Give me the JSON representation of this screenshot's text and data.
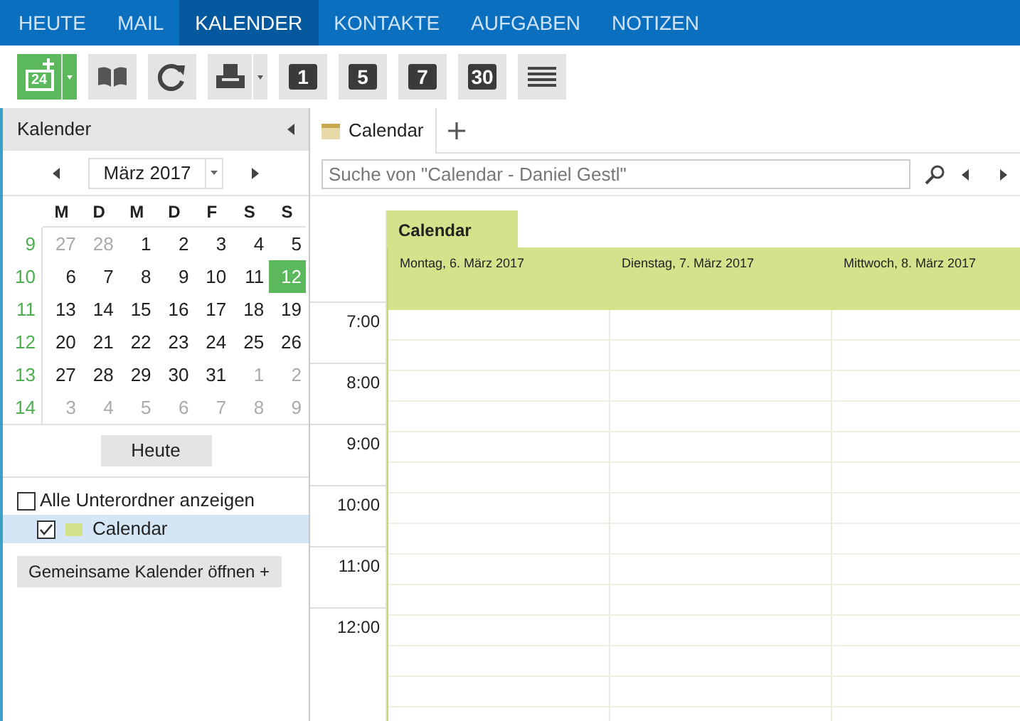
{
  "nav": [
    {
      "label": "HEUTE",
      "selected": false
    },
    {
      "label": "MAIL",
      "selected": false
    },
    {
      "label": "KALENDER",
      "selected": true
    },
    {
      "label": "KONTAKTE",
      "selected": false
    },
    {
      "label": "AUFGABEN",
      "selected": false
    },
    {
      "label": "NOTIZEN",
      "selected": false
    }
  ],
  "toolbar": [
    {
      "kind": "new",
      "text": "24"
    },
    {
      "kind": "book"
    },
    {
      "kind": "refresh"
    },
    {
      "kind": "print"
    },
    {
      "kind": "day",
      "text": "1"
    },
    {
      "kind": "day",
      "text": "5"
    },
    {
      "kind": "day",
      "text": "7"
    },
    {
      "kind": "day",
      "text": "30"
    },
    {
      "kind": "list"
    }
  ],
  "sidebar": {
    "title": "Kalender",
    "month": "März 2017",
    "weekdays": [
      "M",
      "D",
      "M",
      "D",
      "F",
      "S",
      "S"
    ],
    "weeks": [
      {
        "number": "9",
        "days": [
          {
            "label": "27",
            "other": true,
            "selected": false
          },
          {
            "label": "28",
            "other": true,
            "selected": false
          },
          {
            "label": "1",
            "other": false,
            "selected": false
          },
          {
            "label": "2",
            "other": false,
            "selected": false
          },
          {
            "label": "3",
            "other": false,
            "selected": false
          },
          {
            "label": "4",
            "other": false,
            "selected": false
          },
          {
            "label": "5",
            "other": false,
            "selected": false
          }
        ]
      },
      {
        "number": "10",
        "days": [
          {
            "label": "6",
            "other": false,
            "selected": false
          },
          {
            "label": "7",
            "other": false,
            "selected": false
          },
          {
            "label": "8",
            "other": false,
            "selected": false
          },
          {
            "label": "9",
            "other": false,
            "selected": false
          },
          {
            "label": "10",
            "other": false,
            "selected": false
          },
          {
            "label": "11",
            "other": false,
            "selected": false
          },
          {
            "label": "12",
            "other": false,
            "selected": true
          }
        ]
      },
      {
        "number": "11",
        "days": [
          {
            "label": "13",
            "other": false,
            "selected": false
          },
          {
            "label": "14",
            "other": false,
            "selected": false
          },
          {
            "label": "15",
            "other": false,
            "selected": false
          },
          {
            "label": "16",
            "other": false,
            "selected": false
          },
          {
            "label": "17",
            "other": false,
            "selected": false
          },
          {
            "label": "18",
            "other": false,
            "selected": false
          },
          {
            "label": "19",
            "other": false,
            "selected": false
          }
        ]
      },
      {
        "number": "12",
        "days": [
          {
            "label": "20",
            "other": false,
            "selected": false
          },
          {
            "label": "21",
            "other": false,
            "selected": false
          },
          {
            "label": "22",
            "other": false,
            "selected": false
          },
          {
            "label": "23",
            "other": false,
            "selected": false
          },
          {
            "label": "24",
            "other": false,
            "selected": false
          },
          {
            "label": "25",
            "other": false,
            "selected": false
          },
          {
            "label": "26",
            "other": false,
            "selected": false
          }
        ]
      },
      {
        "number": "13",
        "days": [
          {
            "label": "27",
            "other": false,
            "selected": false
          },
          {
            "label": "28",
            "other": false,
            "selected": false
          },
          {
            "label": "29",
            "other": false,
            "selected": false
          },
          {
            "label": "30",
            "other": false,
            "selected": false
          },
          {
            "label": "31",
            "other": false,
            "selected": false
          },
          {
            "label": "1",
            "other": true,
            "selected": false
          },
          {
            "label": "2",
            "other": true,
            "selected": false
          }
        ]
      },
      {
        "number": "14",
        "days": [
          {
            "label": "3",
            "other": true,
            "selected": false
          },
          {
            "label": "4",
            "other": true,
            "selected": false
          },
          {
            "label": "5",
            "other": true,
            "selected": false
          },
          {
            "label": "6",
            "other": true,
            "selected": false
          },
          {
            "label": "7",
            "other": true,
            "selected": false
          },
          {
            "label": "8",
            "other": true,
            "selected": false
          },
          {
            "label": "9",
            "other": true,
            "selected": false
          }
        ]
      }
    ],
    "today_button": "Heute",
    "folders": [
      {
        "label": "Alle Unterordner anzeigen",
        "checked": false,
        "selected": false,
        "kind": "option"
      },
      {
        "label": "Calendar",
        "checked": true,
        "selected": true,
        "kind": "calendar"
      }
    ],
    "shared_button": "Gemeinsame Kalender öffnen +"
  },
  "tabs": [
    {
      "label": "Calendar",
      "selected": true
    }
  ],
  "search": {
    "placeholder": "Suche von \"Calendar - Daniel Gestl\""
  },
  "calendar": {
    "name": "Calendar",
    "days": [
      "Montag, 6. März 2017",
      "Dienstag, 7. März 2017",
      "Mittwoch, 8. März 2017"
    ],
    "times": [
      "7:00",
      "8:00",
      "9:00",
      "10:00",
      "11:00",
      "12:00"
    ]
  }
}
